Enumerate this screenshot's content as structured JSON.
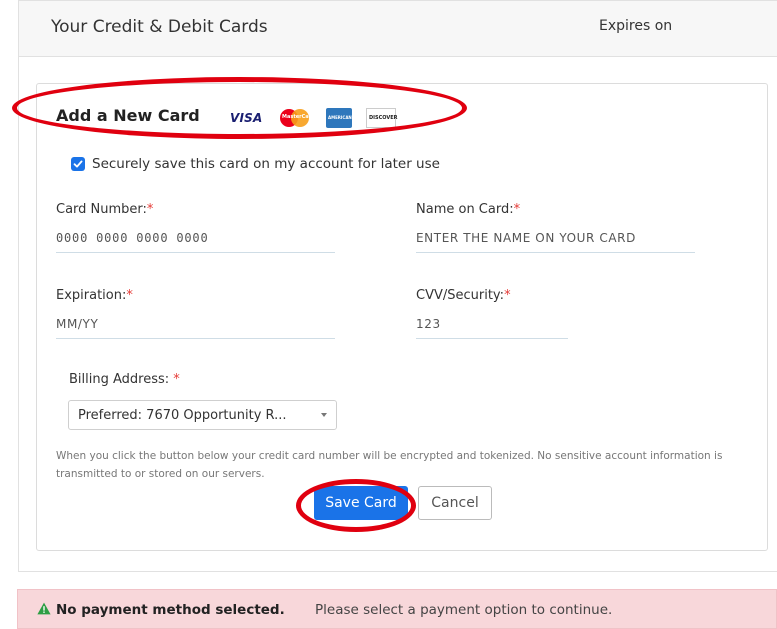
{
  "panel": {
    "title": "Your Credit & Debit Cards",
    "expires_header": "Expires on"
  },
  "form": {
    "heading": "Add a New Card",
    "brand_logos": [
      {
        "name": "visa",
        "text": "VISA"
      },
      {
        "name": "mastercard",
        "text": "MasterCard"
      },
      {
        "name": "american-express",
        "text": "AMERICAN EXPRESS"
      },
      {
        "name": "discover",
        "text": "DISCOVER"
      }
    ],
    "save_checkbox": {
      "checked": true,
      "label": "Securely save this card on my account for later use"
    },
    "card_number": {
      "label": "Card Number:",
      "required": "*",
      "placeholder": "0000 0000 0000 0000"
    },
    "name_on_card": {
      "label": "Name on Card:",
      "required": "*",
      "placeholder": "ENTER THE NAME ON YOUR CARD"
    },
    "expiration": {
      "label": "Expiration:",
      "required": "*",
      "placeholder": "MM/YY"
    },
    "cvv": {
      "label": "CVV/Security:",
      "required": "*",
      "placeholder": "123"
    },
    "billing_address": {
      "label": "Billing Address:",
      "required": "*",
      "selected": "Preferred: 7670 Opportunity R..."
    },
    "disclaimer": "When you click the button below your credit card number will be encrypted and tokenized. No sensitive account information is transmitted to or stored on our servers.",
    "save_button": "Save Card",
    "cancel_button": "Cancel"
  },
  "alert": {
    "strong": "No payment method selected.",
    "text": "Please select a payment option to continue.",
    "icon": "warning-triangle-icon"
  },
  "colors": {
    "accent": "#1a73e8",
    "required": "#e53935",
    "annotation_ring": "#e0000f",
    "alert_bg": "#f8d7da",
    "alert_icon": "#2e9e44"
  }
}
